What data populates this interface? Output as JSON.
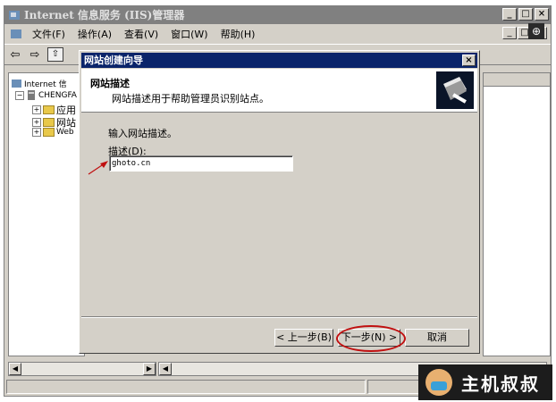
{
  "window": {
    "title": "Internet 信息服务 (IIS)管理器",
    "buttons": {
      "minimize": "_",
      "maximize": "□",
      "close": "×"
    }
  },
  "menubar": {
    "items": [
      "文件(F)",
      "操作(A)",
      "查看(V)",
      "窗口(W)",
      "帮助(H)"
    ]
  },
  "toolbar": {
    "back": "⇦",
    "forward": "⇨",
    "up": "⇧"
  },
  "tree": {
    "root": "Internet 信",
    "server": "CHENGFA",
    "children": [
      "应用",
      "网站",
      "Web"
    ]
  },
  "wizard": {
    "title": "网站创建向导",
    "header_title": "网站描述",
    "header_subtitle": "网站描述用于帮助管理员识别站点。",
    "intro": "输入网站描述。",
    "field_label": "描述(D):",
    "field_value": "ghoto.cn",
    "back_label": "< 上一步(B)",
    "next_label": "下一步(N) >",
    "cancel_label": "取消"
  },
  "watermark": {
    "text": "主机叔叔"
  },
  "colors": {
    "dialog_title_bg": "#0a246a",
    "annotation_red": "#c01010"
  }
}
